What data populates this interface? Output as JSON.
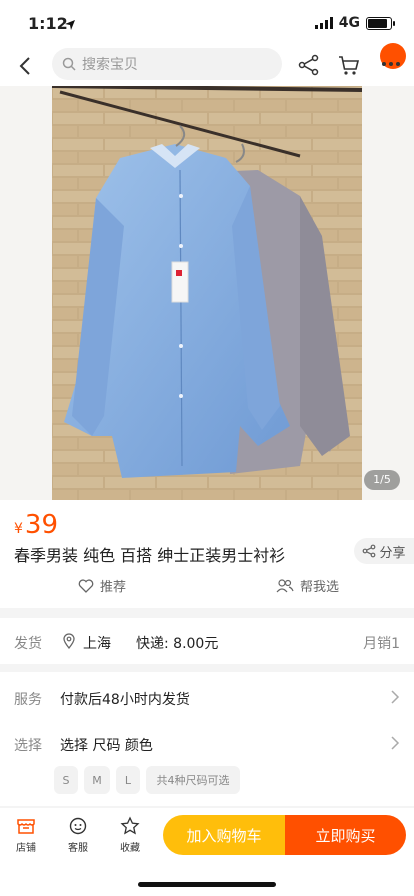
{
  "status_bar": {
    "time": "1:12",
    "network": "4G"
  },
  "search": {
    "placeholder": "搜索宝贝"
  },
  "gallery": {
    "counter": "1/5"
  },
  "product": {
    "currency": "¥",
    "price": "39",
    "title": "春季男装 纯色 百搭 绅士正装男士衬衫",
    "share_label": "分享",
    "recommend_label": "推荐",
    "help_label": "帮我选"
  },
  "shipping": {
    "label": "发货",
    "location": "上海",
    "express": "快递: 8.00元",
    "monthly_sales": "月销1"
  },
  "service": {
    "label": "服务",
    "text": "付款后48小时内发货"
  },
  "select": {
    "label": "选择",
    "text": "选择 尺码 颜色",
    "sizes": [
      "S",
      "M",
      "L"
    ],
    "note": "共4种尺码可选"
  },
  "bottom": {
    "shop": "店铺",
    "service": "客服",
    "favorite": "收藏",
    "add_cart": "加入购物车",
    "buy_now": "立即购买"
  },
  "colors": {
    "accent": "#ff5000",
    "cart": "#ffbe0b"
  }
}
